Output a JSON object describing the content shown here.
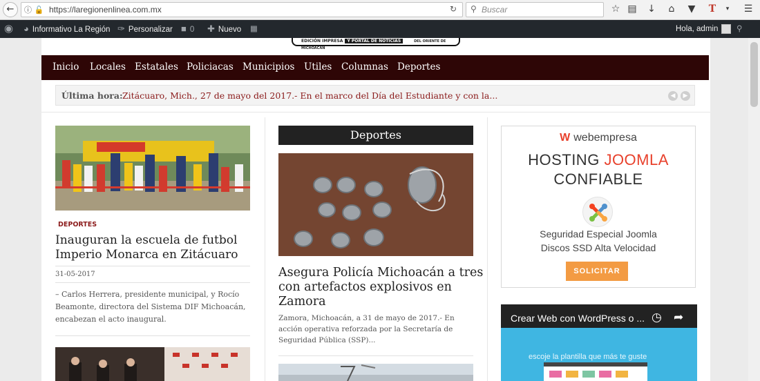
{
  "browser": {
    "url": "https://laregionenlinea.com.mx",
    "search_placeholder": "Buscar",
    "icons": [
      "back-arrow-icon",
      "info-icon",
      "lock-warning-icon",
      "reload-icon",
      "search-icon",
      "bookmark-star-icon",
      "reading-list-icon",
      "download-icon",
      "home-icon",
      "pocket-icon",
      "extension-t-icon",
      "menu-icon"
    ]
  },
  "adminbar": {
    "site_name": "Informativo La Región",
    "customize": "Personalizar",
    "comments_count": "0",
    "new_label": "Nuevo",
    "greeting": "Hola, admin"
  },
  "header": {
    "logo_left": "EDICIÓN IMPRESA",
    "logo_mid": "Y PORTAL DE NOTICIAS",
    "logo_right": "DEL ORIENTE DE MICHOACÁN"
  },
  "menu": [
    "Inicio",
    "Locales",
    "Estatales",
    "Policiacas",
    "Municipios",
    "Utiles",
    "Columnas",
    "Deportes"
  ],
  "ticker": {
    "label": "Última hora:",
    "text": "Zitácuaro, Mich., 27 de mayo del 2017.- En el marco del Día del Estudiante y con la..."
  },
  "left_article": {
    "category": "DEPORTES",
    "title_line1": "Inauguran la escuela de futbol",
    "title_line2": "Imperio Monarca en Zitácuaro",
    "date": "31-05-2017",
    "excerpt_line1": "– Carlos Herrera, presidente municipal, y Rocío",
    "excerpt_line2": "Beamonte, directora del Sistema DIF Michoacán,",
    "excerpt_line3": "encabezan el acto inaugural."
  },
  "mid_section": {
    "title": "Deportes",
    "article_title_line1": "Asegura Policía Michoacán a tres",
    "article_title_line2": "con artefactos explosivos en",
    "article_title_line3": "Zamora",
    "excerpt_line1": "Zamora, Michoacán, a 31 de mayo de 2017.- En",
    "excerpt_line2": "acción operativa reforzada por la Secretaría de",
    "excerpt_line3": "Seguridad Pública (SSP)..."
  },
  "ad": {
    "brand": "webempresa",
    "headline_a": "HOSTING",
    "headline_b": "JOOMLA",
    "headline_c": "CONFIABLE",
    "line1": "Seguridad Especial Joomla",
    "line2": "Discos SSD Alta Velocidad",
    "button": "SOLICITAR"
  },
  "video": {
    "title": "Crear Web con WordPress o ...",
    "overlay_text": "escoje la plantilla que más te guste"
  }
}
